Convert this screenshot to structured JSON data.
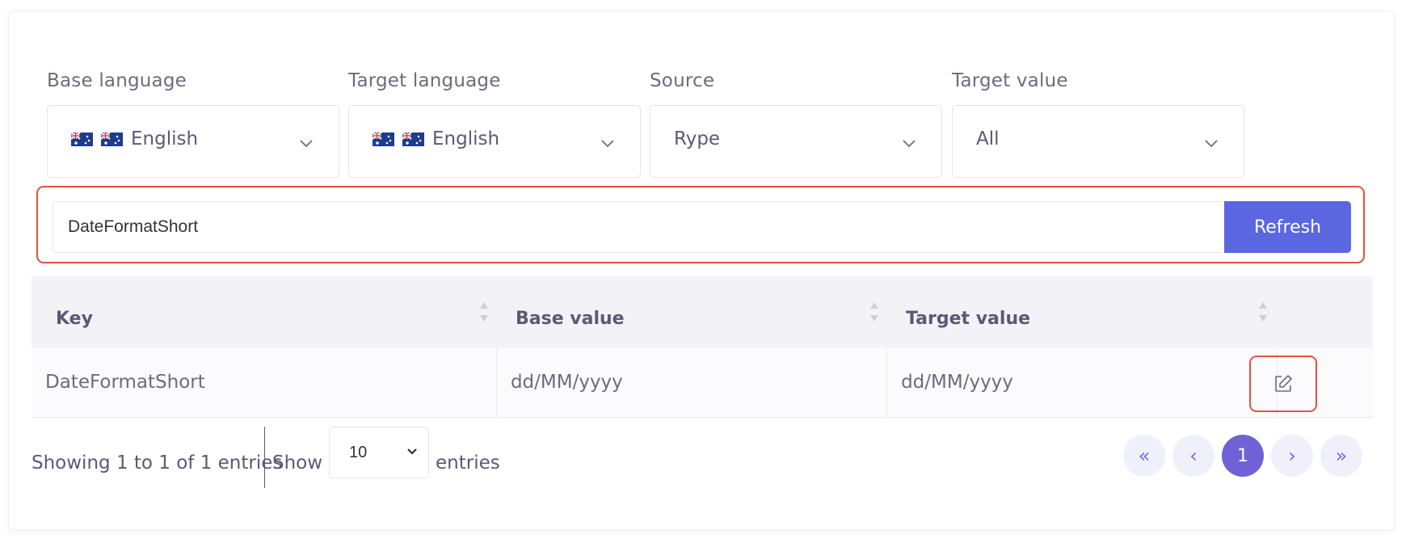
{
  "filters": {
    "base_language": {
      "label": "Base language",
      "value": "English"
    },
    "target_language": {
      "label": "Target language",
      "value": "English"
    },
    "source": {
      "label": "Source",
      "value": "Rype"
    },
    "target_value": {
      "label": "Target value",
      "value": "All"
    }
  },
  "search": {
    "value": "DateFormatShort",
    "refresh_label": "Refresh"
  },
  "table": {
    "headers": [
      "Key",
      "Base value",
      "Target value"
    ],
    "rows": [
      {
        "key": "DateFormatShort",
        "base_value": "dd/MM/yyyy",
        "target_value": "dd/MM/yyyy"
      }
    ]
  },
  "footer": {
    "info": "Showing 1 to 1 of 1 entries",
    "show_label": "Show",
    "page_length": "10",
    "entries_label": "entries"
  },
  "pagination": {
    "first": "«",
    "prev": "‹",
    "current": "1",
    "next": "›",
    "last": "»"
  },
  "colors": {
    "accent": "#5a67e0",
    "highlight_border": "#e0533e",
    "pagination_active": "#6e62d6"
  },
  "icons": {
    "flag": "australia-flag-icon",
    "chevron": "chevron-down-icon",
    "sort": "sort-icon",
    "edit": "edit-icon"
  }
}
